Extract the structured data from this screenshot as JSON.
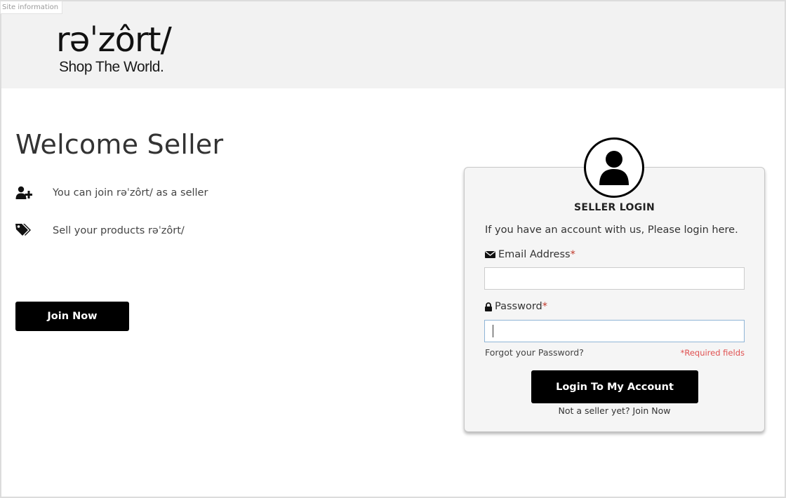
{
  "site_info": {
    "label": "Site information"
  },
  "header": {
    "logo_main": "rəˈzôrt/",
    "logo_tagline": "Shop The World."
  },
  "welcome": {
    "title": "Welcome Seller",
    "features": [
      {
        "icon": "user-plus-icon",
        "text": "You can join rəˈzôrt/ as a seller"
      },
      {
        "icon": "tags-icon",
        "text": "Sell your products rəˈzôrt/"
      }
    ],
    "join_button": "Join Now"
  },
  "login": {
    "avatar_icon": "user-icon",
    "title": "SELLER LOGIN",
    "intro": "If you have an account with us, Please login here.",
    "email": {
      "icon": "envelope-icon",
      "label": "Email Address",
      "required_mark": "*",
      "value": "",
      "placeholder": ""
    },
    "password": {
      "icon": "lock-icon",
      "label": "Password",
      "required_mark": "*",
      "value": "",
      "placeholder": ""
    },
    "forgot_link": "Forgot your Password?",
    "required_note": "*Required fields",
    "submit_button": "Login To My Account",
    "join_link": "Not a seller yet? Join Now"
  },
  "colors": {
    "button_bg": "#000000",
    "header_bg": "#f2f2f2",
    "required_red": "#c0392b"
  }
}
